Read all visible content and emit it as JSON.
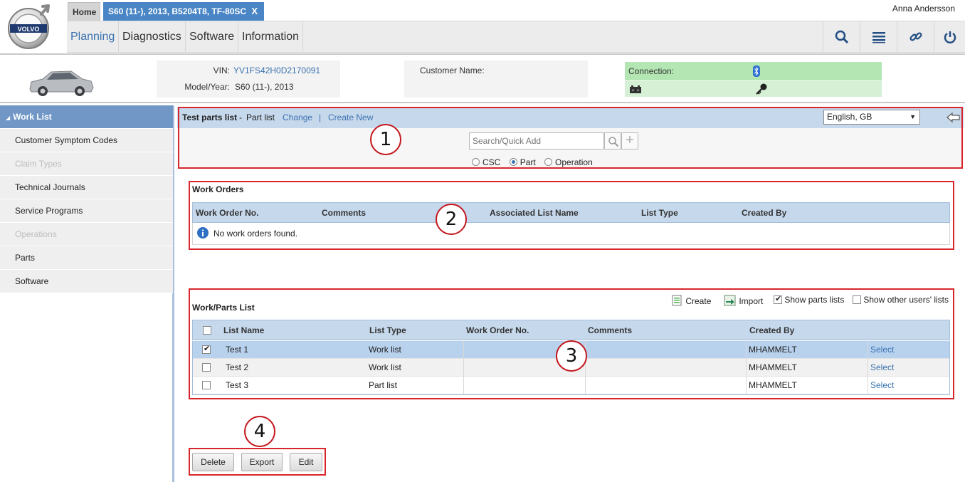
{
  "header": {
    "logo_text": "VOLVO",
    "tabs": [
      {
        "label": "Home"
      },
      {
        "label": "S60 (11-), 2013, B5204T8, TF-80SC",
        "close": "X"
      }
    ],
    "user_name": "Anna Andersson",
    "nav": [
      "Planning",
      "Diagnostics",
      "Software",
      "Information"
    ],
    "tools": [
      "search-icon",
      "list-icon",
      "link-icon",
      "power-icon"
    ]
  },
  "vehicle": {
    "vin_label": "VIN:",
    "vin": "YV1FS42H0D2170091",
    "model_label": "Model/Year:",
    "model": "S60 (11-), 2013",
    "customer_label": "Customer Name:",
    "connection_label": "Connection:"
  },
  "sidebar": {
    "items": [
      {
        "label": "Work List",
        "state": "active"
      },
      {
        "label": "Customer Symptom Codes",
        "state": "normal"
      },
      {
        "label": "Claim Types",
        "state": "disabled"
      },
      {
        "label": "Technical Journals",
        "state": "normal"
      },
      {
        "label": "Service Programs",
        "state": "normal"
      },
      {
        "label": "Operations",
        "state": "disabled"
      },
      {
        "label": "Parts",
        "state": "normal"
      },
      {
        "label": "Software",
        "state": "normal"
      }
    ]
  },
  "panel1": {
    "list_title": "Test parts list",
    "dash": "-",
    "list_type": "Part list",
    "change": "Change",
    "sep": "|",
    "create_new": "Create New",
    "language": "English, GB",
    "search_placeholder": "Search/Quick Add",
    "radios": [
      {
        "label": "CSC",
        "checked": false
      },
      {
        "label": "Part",
        "checked": true
      },
      {
        "label": "Operation",
        "checked": false
      }
    ]
  },
  "work_orders": {
    "title": "Work Orders",
    "columns": [
      "Work Order No.",
      "Comments",
      "Associated List Name",
      "List Type",
      "Created By"
    ],
    "empty_message": "No work orders found."
  },
  "parts_list": {
    "title": "Work/Parts List",
    "actions": {
      "create": "Create",
      "import": "Import",
      "show_parts": "Show parts lists",
      "show_other": "Show other users' lists"
    },
    "show_parts_checked": true,
    "show_other_checked": false,
    "columns": [
      "List Name",
      "List Type",
      "Work Order No.",
      "Comments",
      "Created By"
    ],
    "rows": [
      {
        "name": "Test 1",
        "type": "Work list",
        "work_order": "",
        "comments": "",
        "created_by": "MHAMMELT",
        "action": "Select",
        "checked": true
      },
      {
        "name": "Test 2",
        "type": "Work list",
        "work_order": "",
        "comments": "",
        "created_by": "MHAMMELT",
        "action": "Select",
        "checked": false
      },
      {
        "name": "Test 3",
        "type": "Part list",
        "work_order": "",
        "comments": "",
        "created_by": "MHAMMELT",
        "action": "Select",
        "checked": false
      }
    ]
  },
  "buttons": {
    "delete": "Delete",
    "export": "Export",
    "edit": "Edit"
  },
  "callouts": [
    "1",
    "2",
    "3",
    "4"
  ],
  "colors": {
    "accent": "#3a72b0",
    "tab_active": "#4a86c5",
    "highlight_red": "#d8262c",
    "connection_green": "#b3e6b3",
    "row_selected": "#b8d2ee"
  }
}
